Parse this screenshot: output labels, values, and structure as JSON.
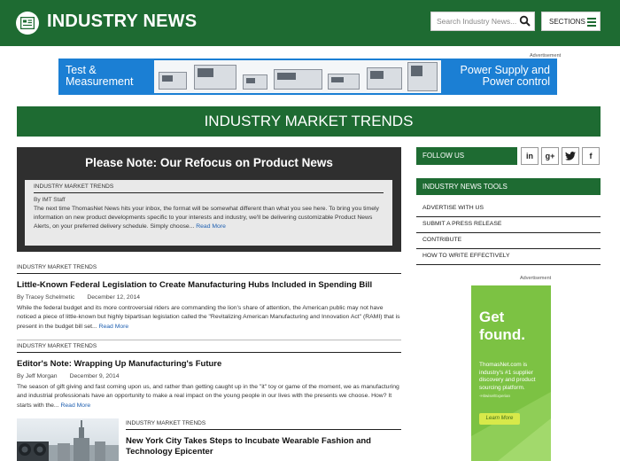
{
  "header": {
    "title": "INDUSTRY NEWS",
    "search_placeholder": "Search Industry News...",
    "sections_label": "SECTIONS"
  },
  "top_ad": {
    "label": "Advertisement",
    "left_line1": "Test &",
    "left_line2": "Measurement",
    "right_line1": "Power Supply and",
    "right_line2": "Power control"
  },
  "page_title": "INDUSTRY MARKET TRENDS",
  "note": {
    "title": "Please Note: Our Refocus on Product News",
    "category": "INDUSTRY MARKET TRENDS",
    "author": "By IMT Staff",
    "body": "The next time ThomasNet News hits your inbox, the format will be somewhat different than what you see here. To bring you timely information on new product developments specific to your interests and industry, we'll be delivering customizable Product News Alerts, on your preferred delivery schedule. Simply choose... ",
    "read_more": "Read More"
  },
  "articles": [
    {
      "category": "INDUSTRY MARKET TRENDS",
      "headline": "Little-Known Federal Legislation to Create Manufacturing Hubs Included in Spending Bill",
      "author": "By Tracey Schelmetic",
      "date": "December 12, 2014",
      "body": "While the federal budget and its more controversial riders are commanding the lion's share of attention, the American public may not have noticed a piece of little-known but highly bipartisan legislation called the \"Revitalizing American Manufacturing and Innovation Act\" (RAMI) that is present in the budget bill set... ",
      "read_more": "Read More"
    },
    {
      "category": "INDUSTRY MARKET TRENDS",
      "headline": "Editor's Note: Wrapping Up Manufacturing's Future",
      "author": "By Jeff Morgan",
      "date": "December 9, 2014",
      "body": "The season of gift giving and fast coming upon us, and rather than getting caught up in the \"it\" toy or game of the moment, we as manufacturing and industrial professionals have an opportunity to make a real impact on the young people in our lives with the presents we choose. How? It starts with the... ",
      "read_more": "Read More"
    },
    {
      "category": "INDUSTRY MARKET TRENDS",
      "headline": "New York City Takes Steps to Incubate Wearable Fashion and Technology Epicenter"
    }
  ],
  "sidebar": {
    "follow_label": "FOLLOW US",
    "social": [
      "in",
      "g+",
      "t",
      "f"
    ],
    "tools_title": "INDUSTRY NEWS TOOLS",
    "tools": [
      "ADVERTISE WITH US",
      "SUBMIT A PRESS RELEASE",
      "CONTRIBUTE",
      "HOW TO WRITE EFFECTIVELY"
    ],
    "ad_label": "Advertisement",
    "ad": {
      "headline_line1": "Get",
      "headline_line2": "found.",
      "text": "ThomasNet.com is industry's #1 supplier discovery and product sourcing platform.",
      "credit": "-Hitwise/Experian",
      "button": "Learn More"
    }
  },
  "colors": {
    "brand_green": "#1e6b32",
    "link_blue": "#1e5fb0",
    "banner_blue": "#1b7fd4",
    "ad_green": "#7cc243"
  }
}
